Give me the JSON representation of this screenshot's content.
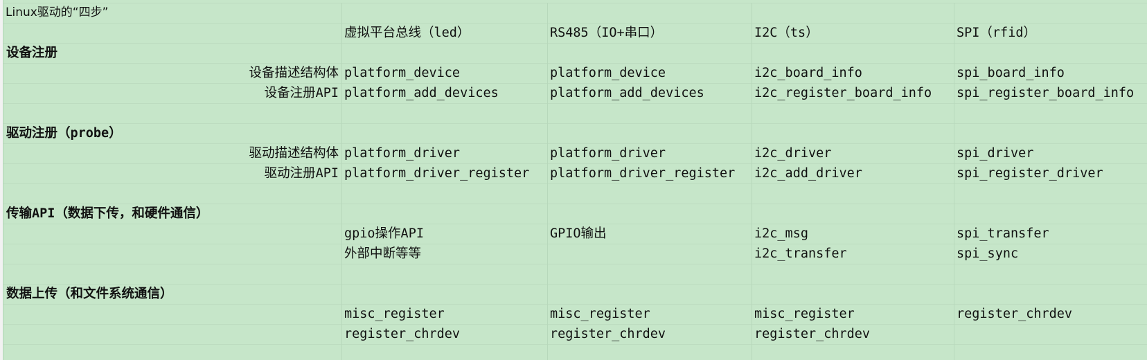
{
  "sheet": {
    "title": "Linux驱动的“四步”",
    "headers": [
      "虚拟平台总线（led）",
      "RS485（IO+串口）",
      "I2C（ts）",
      "SPI（rfid）"
    ],
    "sections": [
      {
        "name": "设备注册",
        "rows": [
          {
            "label": "设备描述结构体",
            "values": [
              "platform_device",
              "platform_device",
              "i2c_board_info",
              "spi_board_info"
            ]
          },
          {
            "label": "设备注册API",
            "values": [
              "platform_add_devices",
              "platform_add_devices",
              "i2c_register_board_info",
              "spi_register_board_info"
            ]
          }
        ]
      },
      {
        "name": "驱动注册（probe）",
        "rows": [
          {
            "label": "驱动描述结构体",
            "values": [
              "platform_driver",
              "platform_driver",
              "i2c_driver",
              "spi_driver"
            ]
          },
          {
            "label": "驱动注册API",
            "values": [
              "platform_driver_register",
              "platform_driver_register",
              "i2c_add_driver",
              "spi_register_driver"
            ]
          }
        ]
      },
      {
        "name": "传输API（数据下传，和硬件通信）",
        "rows": [
          {
            "label": "",
            "values": [
              "gpio操作API",
              "GPIO输出",
              "i2c_msg",
              "spi_transfer"
            ]
          },
          {
            "label": "",
            "values": [
              "外部中断等等",
              "",
              "i2c_transfer",
              "spi_sync"
            ]
          }
        ]
      },
      {
        "name": "数据上传（和文件系统通信）",
        "rows": [
          {
            "label": "",
            "values": [
              "misc_register",
              "misc_register",
              "misc_register",
              "register_chrdev"
            ]
          },
          {
            "label": "",
            "values": [
              "register_chrdev",
              "register_chrdev",
              "register_chrdev",
              ""
            ]
          }
        ]
      }
    ]
  },
  "colors": {
    "cell_fill": "#c6e6c9",
    "grid_line": "#bddcc0",
    "selected_column_accent": "#5fae65"
  }
}
